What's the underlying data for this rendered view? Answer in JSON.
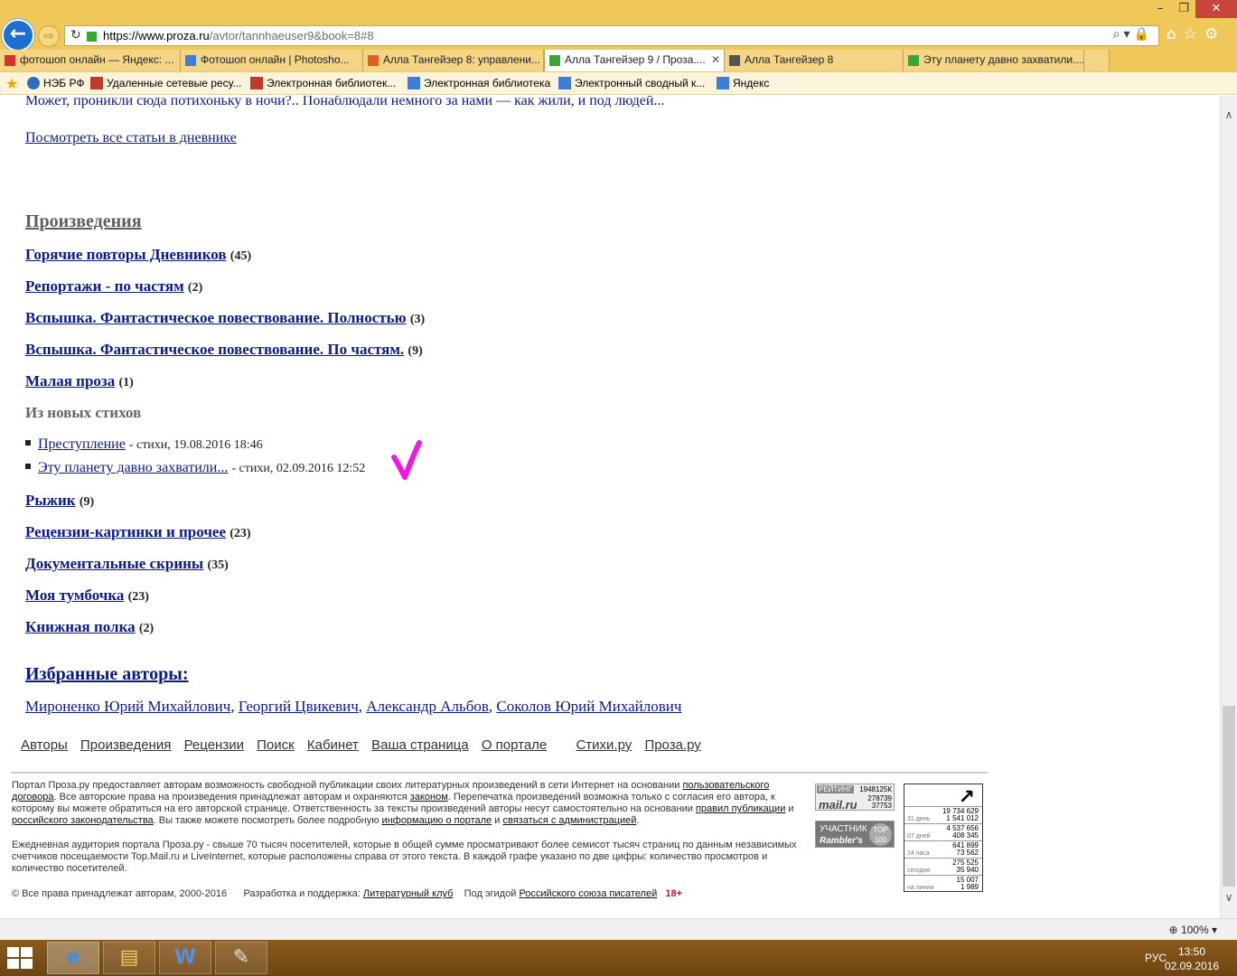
{
  "browser": {
    "url_host": "https://www.proza.ru",
    "url_path": "/avtor/tannhaeuser9&book=8#8",
    "tabs": [
      {
        "label": "фотошоп онлайн — Яндекс: ...",
        "icon_color": "#d9302c"
      },
      {
        "label": "Фотошоп онлайн | Photosho...",
        "icon_color": "#3c7fd8"
      },
      {
        "label": "Алла Тангейзер 8: управлени...",
        "icon_color": "#e65c1e"
      },
      {
        "label": "Алла Тангейзер 9 / Проза....",
        "icon_color": "#37a637",
        "active": true
      },
      {
        "label": "Алла Тангейзер 8",
        "icon_color": "#555555"
      },
      {
        "label": "Эту планету давно захватили....",
        "icon_color": "#37a637"
      }
    ],
    "favorites": [
      "НЭБ РФ",
      "Удаленные сетевые ресу...",
      "Электронная библиотек...",
      "Электронная библиотека",
      "Электронный сводный к...",
      "Яндекс"
    ],
    "zoom": "100%"
  },
  "page": {
    "top_text": "Может, проникли сюда потихоньку в ночи?.. Понаблюдали немного за нами — как жили, и под людей...",
    "diary_link": "Посмотреть все статьи в дневнике",
    "works_title": "Произведения",
    "works": [
      {
        "title": "Горячие повторы Дневников",
        "count": "(45)"
      },
      {
        "title": "Репортажи - по частям",
        "count": "(2)"
      },
      {
        "title": "Вспышка. Фантастическое повествование. Полностью",
        "count": "(3)"
      },
      {
        "title": "Вспышка. Фантастическое повествование. По частям.",
        "count": "(9)"
      },
      {
        "title": "Малая проза",
        "count": "(1)"
      }
    ],
    "new_poems_title": "Из новых стихов",
    "new_poems": [
      {
        "title": "Преступление",
        "meta": "- стихи, 19.08.2016 18:46"
      },
      {
        "title": "Эту планету давно захватили...",
        "meta": "- стихи, 02.09.2016 12:52"
      }
    ],
    "works2": [
      {
        "title": "Рыжик",
        "count": "(9)"
      },
      {
        "title": "Рецензии-картинки и прочее",
        "count": "(23)"
      },
      {
        "title": "Документальные скрины",
        "count": "(35)"
      },
      {
        "title": "Моя тумбочка",
        "count": "(23)"
      },
      {
        "title": "Книжная полка",
        "count": "(2)"
      }
    ],
    "fav_authors_title": "Избранные авторы:",
    "fav_authors": [
      "Мироненко Юрий Михайлович",
      "Георгий Цвикевич",
      "Александр Альбов",
      "Соколов Юрий Михайлович"
    ],
    "annotation_color": "#f019e0"
  },
  "footer": {
    "nav": [
      "Авторы",
      "Произведения",
      "Рецензии",
      "Поиск",
      "Кабинет",
      "Ваша страница",
      "О портале"
    ],
    "nav2": [
      "Стихи.ру",
      "Проза.ру"
    ],
    "p1_a": "Портал Проза.ру предоставляет авторам возможность свободной публикации своих литературных произведений в сети Интернет на основании",
    "p1_link1": "пользовательского договора",
    "p1_b": ". Все авторские права на произведения принадлежат авторам и охраняются",
    "p1_link2": "законом",
    "p1_c": ". Перепечатка произведений возможна только с согласия его автора, к которому вы можете обратиться на его авторской странице. Ответственность за тексты произведений авторы несут самостоятельно на основании",
    "p1_link3": "правил публикации",
    "p1_d": "и",
    "p1_link4": "российского законодательства",
    "p1_e": ". Вы также можете посмотреть более подробную",
    "p1_link5": "информацию о портале",
    "p1_f": "и",
    "p1_link6": "связаться с администрацией",
    "p2": "Ежедневная аудитория портала Проза.ру - свыше 70 тысяч посетителей, которые в общей сумме просматривают более семисот тысяч страниц по данным независимых счетчиков посещаемости Top.Mail.ru и LiveInternet, которые расположены справа от этого текста. В каждой графе указано по две цифры: количество просмотров и количество посетителей.",
    "copyright": "© Все права принадлежат авторам, 2000-2016",
    "dev_label": "Разработка и поддержка:",
    "dev_link": "Литературный клуб",
    "aegis_label": "Под эгидой",
    "aegis_link": "Российского союза писателей",
    "age": "18+",
    "mail_counter": {
      "label": "РЕЙТИНГ",
      "v1": "1948125К",
      "v2": "278739",
      "v3": "37753",
      "brand": "mail.ru"
    },
    "rambler": {
      "line1": "УЧАСТНИК",
      "line2": "Rambler's",
      "badge": "TOP 100"
    },
    "li_rows": [
      {
        "label": "31 день",
        "v1": "19 734 629",
        "v2": "1 541 012"
      },
      {
        "label": "07 дней",
        "v1": "4 537 656",
        "v2": "408 345"
      },
      {
        "label": "24 часа",
        "v1": "641 899",
        "v2": "73 562"
      },
      {
        "label": "сегодня",
        "v1": "275 525",
        "v2": "35 940"
      },
      {
        "label": "на линии",
        "v1": "15 007",
        "v2": "1 989"
      }
    ]
  },
  "taskbar": {
    "lang": "РУС",
    "time": "13:50",
    "date": "02.09.2016"
  }
}
